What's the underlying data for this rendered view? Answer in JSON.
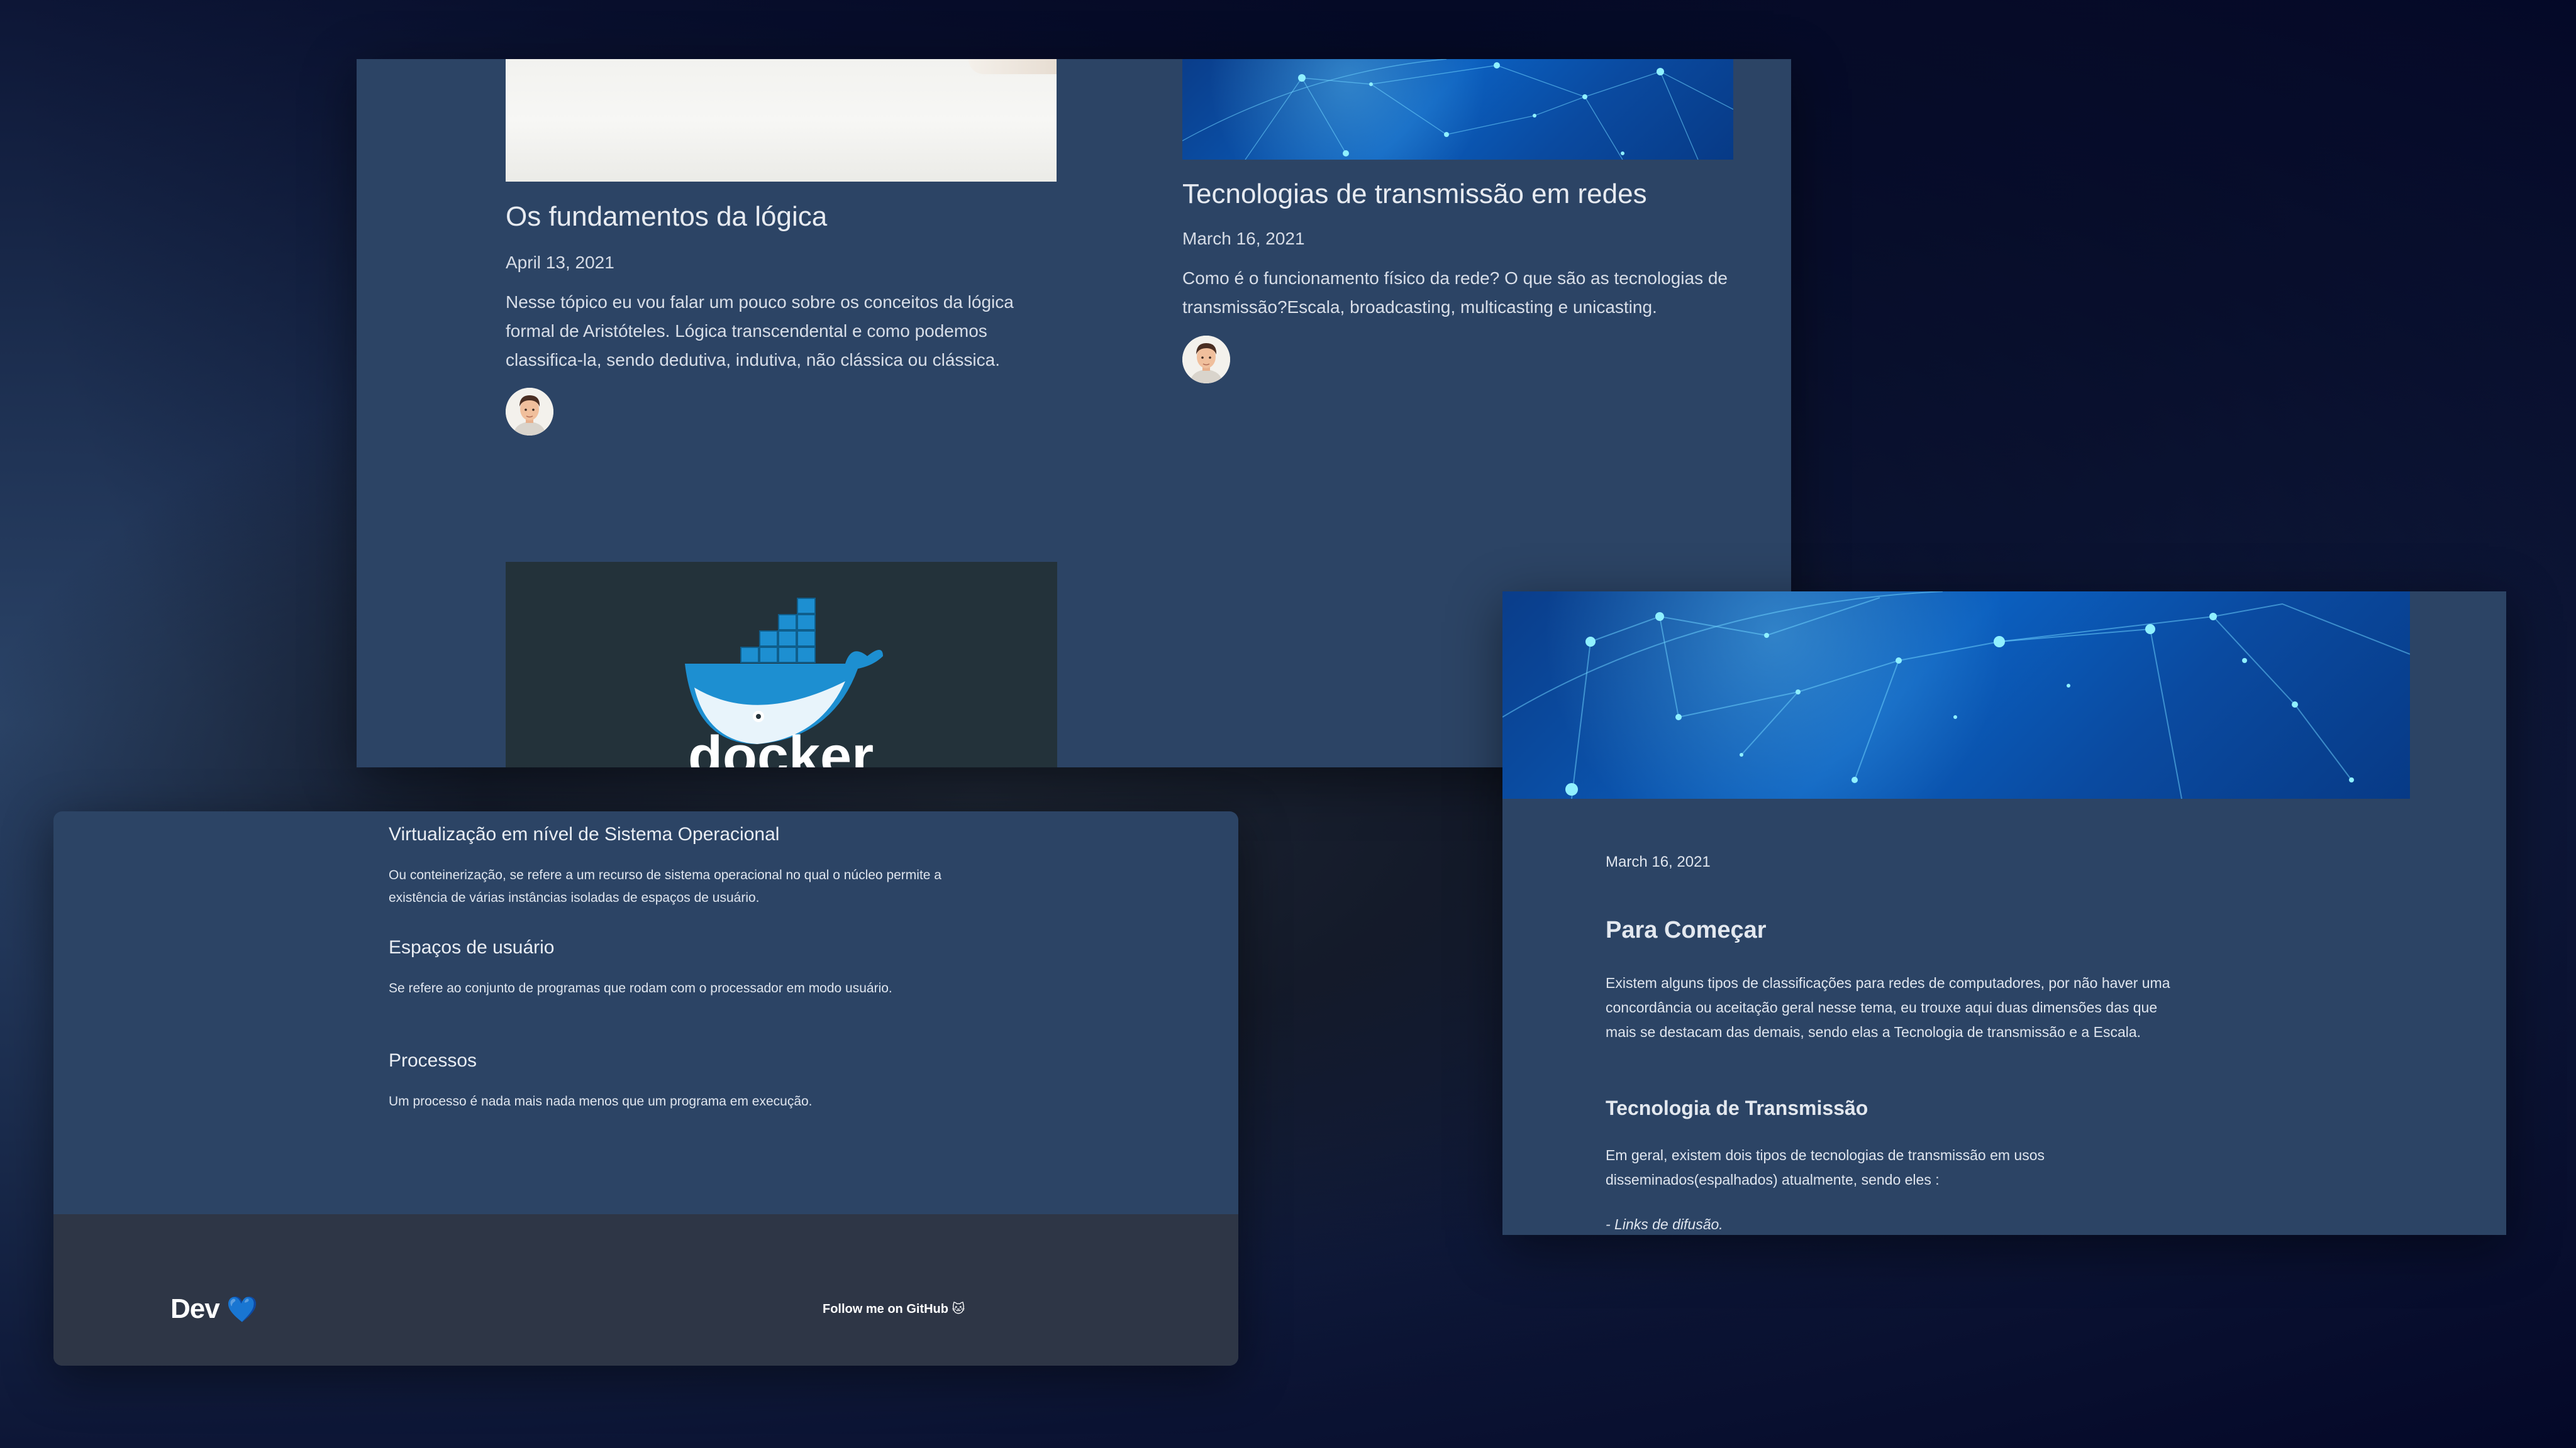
{
  "blog_list": {
    "posts": [
      {
        "title": "Os fundamentos da lógica",
        "date": "April 13, 2021",
        "description": "Nesse tópico eu vou falar um pouco sobre os conceitos da lógica formal de Aristóteles. Lógica transcendental e como podemos classifica-la, sendo dedutiva, indutiva, não clássica ou clássica."
      },
      {
        "title": "Tecnologias de transmissão em redes",
        "date": "March 16, 2021",
        "description": "Como é o funcionamento físico da rede? O que são as tecnologias de transmissão?Escala, broadcasting, multicasting e unicasting."
      }
    ]
  },
  "article_left": {
    "sections": [
      {
        "heading": "Virtualização em nível de Sistema Operacional",
        "body": "Ou conteinerização, se refere a um recurso de sistema operacional no qual o núcleo permite a existência de várias instâncias isoladas de espaços de usuário."
      },
      {
        "heading": "Espaços de usuário",
        "body": "Se refere ao conjunto de programas que rodam com o processador em modo usuário."
      },
      {
        "heading": "Processos",
        "body": "Um processo é nada mais nada menos que um programa em execução."
      }
    ],
    "footer": {
      "brand": "Dev",
      "brand_emoji": "💙",
      "github_link": "Follow me on GitHub 🐱"
    }
  },
  "article_right": {
    "date": "March 16, 2021",
    "heading": "Para Começar",
    "intro": "Existem alguns tipos de classificações para redes de computadores, por não haver uma concordância ou aceitação geral nesse tema, eu trouxe aqui duas dimensões das que mais se destacam das demais, sendo elas a Tecnologia de transmissão e a Escala.",
    "subheading": "Tecnologia de Transmissão",
    "body": "Em geral, existem dois tipos de tecnologias de transmissão em usos disseminados(espalhados) atualmente, sendo eles :",
    "list_item": "- Links de difusão."
  },
  "colors": {
    "panel_bg": "#2c4465",
    "footer_bg": "#2e3646",
    "docker_bg": "#23323a",
    "docker_blue": "#1d8fd1"
  },
  "icons": [
    "avatar-icon",
    "docker-whale-icon",
    "blue-heart-icon",
    "cat-icon"
  ]
}
